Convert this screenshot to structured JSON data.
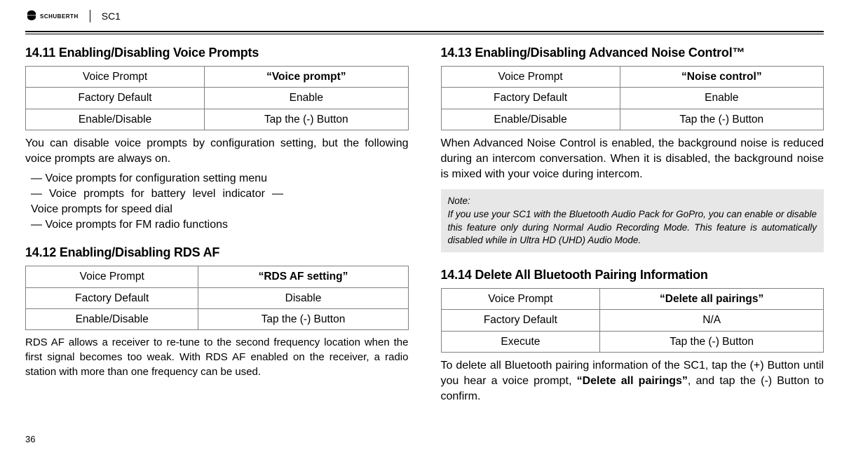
{
  "header": {
    "brand": "SCHUBERTH",
    "product": "SC1"
  },
  "left": {
    "s1411": {
      "title": "14.11 Enabling/Disabling Voice Prompts",
      "table": {
        "r1c1": "Voice Prompt",
        "r1c2": "“Voice prompt”",
        "r2c1": "Factory Default",
        "r2c2": "Enable",
        "r3c1": "Enable/Disable",
        "r3c2": "Tap the (-) Button"
      },
      "para": "You can disable voice prompts by configuration setting, but the following voice prompts are always on.",
      "items": [
        "— Voice prompts for configuration setting menu",
        "— Voice prompts for battery level indicator — Voice prompts for speed dial",
        "— Voice prompts for FM radio functions"
      ]
    },
    "s1412": {
      "title": "14.12 Enabling/Disabling RDS AF",
      "table": {
        "r1c1": "Voice Prompt",
        "r1c2": "“RDS AF setting”",
        "r2c1": "Factory Default",
        "r2c2": "Disable",
        "r3c1": "Enable/Disable",
        "r3c2": "Tap the (-) Button"
      },
      "para": "RDS AF allows a receiver to re-tune to the second frequency location when the first signal becomes too weak. With RDS AF enabled on the receiver, a radio station with more than one frequency can be used."
    }
  },
  "right": {
    "s1413": {
      "title": "14.13 Enabling/Disabling Advanced Noise Control™",
      "table": {
        "r1c1": "Voice Prompt",
        "r1c2": "“Noise control”",
        "r2c1": "Factory Default",
        "r2c2": "Enable",
        "r3c1": "Enable/Disable",
        "r3c2": "Tap the (-) Button"
      },
      "para": "When Advanced Noise Control is enabled, the background noise is reduced during an intercom conversation. When it is disabled, the background noise is mixed with your voice during intercom.",
      "note_title": "Note:",
      "note_body": "If you use your SC1 with the Bluetooth Audio Pack for GoPro, you can enable or disable this feature only during Normal Audio Recording Mode. This feature is automatically disabled while in Ultra HD (UHD) Audio Mode."
    },
    "s1414": {
      "title": "14.14 Delete All Bluetooth Pairing Information",
      "table": {
        "r1c1": "Voice Prompt",
        "r1c2": "“Delete all pairings”",
        "r2c1": "Factory Default",
        "r2c2": "N/A",
        "r3c1": "Execute",
        "r3c2": "Tap the (-) Button"
      },
      "para_a": "To delete all Bluetooth pairing information of the SC1, tap the (+) Button until you hear a voice prompt, ",
      "para_bold": "“Delete all pairings”",
      "para_b": ", and tap the (-) Button to confirm."
    }
  },
  "pagenum": "36"
}
